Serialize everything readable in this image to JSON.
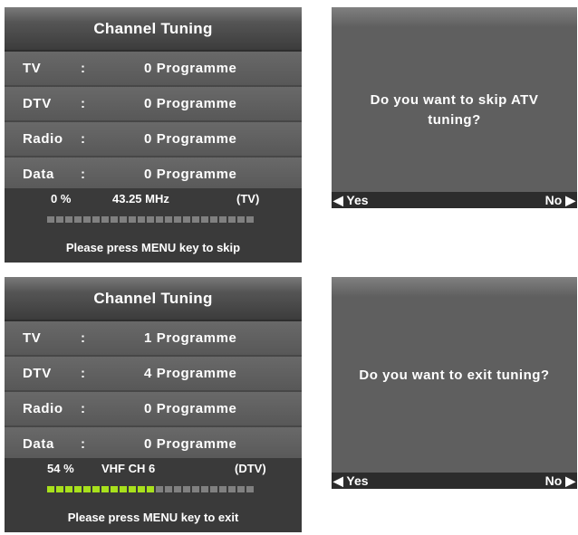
{
  "scan": {
    "title": "Channel Tuning",
    "rows": [
      {
        "label": "TV",
        "count": "0 Programme"
      },
      {
        "label": "DTV",
        "count": "0 Programme"
      },
      {
        "label": "Radio",
        "count": "0 Programme"
      },
      {
        "label": "Data",
        "count": "0 Programme"
      }
    ],
    "percent": "0 %",
    "frequency": "43.25 MHz",
    "mode": "(TV)",
    "progress_fraction": 0.0,
    "hint": "Please press MENU key to skip"
  },
  "scan2": {
    "title": "Channel Tuning",
    "rows": [
      {
        "label": "TV",
        "count": "1 Programme"
      },
      {
        "label": "DTV",
        "count": "4 Programme"
      },
      {
        "label": "Radio",
        "count": "0 Programme"
      },
      {
        "label": "Data",
        "count": "0 Programme"
      }
    ],
    "percent": "54 %",
    "frequency": "VHF  CH 6",
    "mode": "(DTV)",
    "progress_fraction": 0.54,
    "hint": "Please press MENU key to exit"
  },
  "colon": ":",
  "dialog_skip": {
    "question": "Do you want to skip ATV tuning?",
    "yes": "◀ Yes",
    "no": "No ▶"
  },
  "dialog_exit": {
    "question": "Do you want to exit tuning?",
    "yes": "◀ Yes",
    "no": "No ▶"
  },
  "colors": {
    "panel": "#5f5f5f",
    "status_bar": "#3a3a3a",
    "progress_on": "#a8e01c",
    "progress_off": "#808080"
  }
}
